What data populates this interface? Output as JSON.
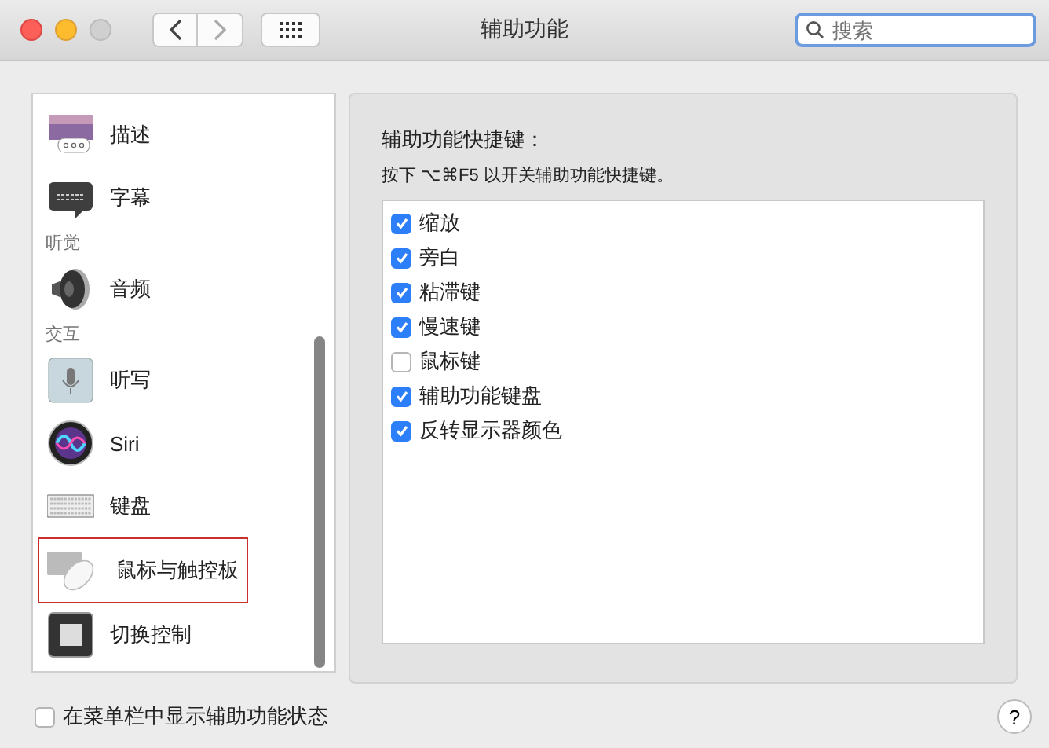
{
  "window": {
    "title": "辅助功能"
  },
  "search": {
    "placeholder": "搜索"
  },
  "sidebar": {
    "items": [
      {
        "kind": "item",
        "label": "描述",
        "highlighted": false
      },
      {
        "kind": "item",
        "label": "字幕",
        "highlighted": false
      },
      {
        "kind": "heading",
        "label": "听觉"
      },
      {
        "kind": "item",
        "label": "音频",
        "highlighted": false
      },
      {
        "kind": "heading",
        "label": "交互"
      },
      {
        "kind": "item",
        "label": "听写",
        "highlighted": false
      },
      {
        "kind": "item",
        "label": "Siri",
        "highlighted": false
      },
      {
        "kind": "item",
        "label": "键盘",
        "highlighted": false
      },
      {
        "kind": "item",
        "label": "鼠标与触控板",
        "highlighted": true
      },
      {
        "kind": "item",
        "label": "切换控制",
        "highlighted": false
      }
    ]
  },
  "panel": {
    "heading": "辅助功能快捷键：",
    "hint": "按下 ⌥⌘F5 以开关辅助功能快捷键。",
    "options": [
      {
        "label": "缩放",
        "checked": true
      },
      {
        "label": "旁白",
        "checked": true
      },
      {
        "label": "粘滞键",
        "checked": true
      },
      {
        "label": "慢速键",
        "checked": true
      },
      {
        "label": "鼠标键",
        "checked": false
      },
      {
        "label": "辅助功能键盘",
        "checked": true
      },
      {
        "label": "反转显示器颜色",
        "checked": true
      }
    ]
  },
  "footer": {
    "menu_status": {
      "label": "在菜单栏中显示辅助功能状态",
      "checked": false
    },
    "help": "?"
  }
}
